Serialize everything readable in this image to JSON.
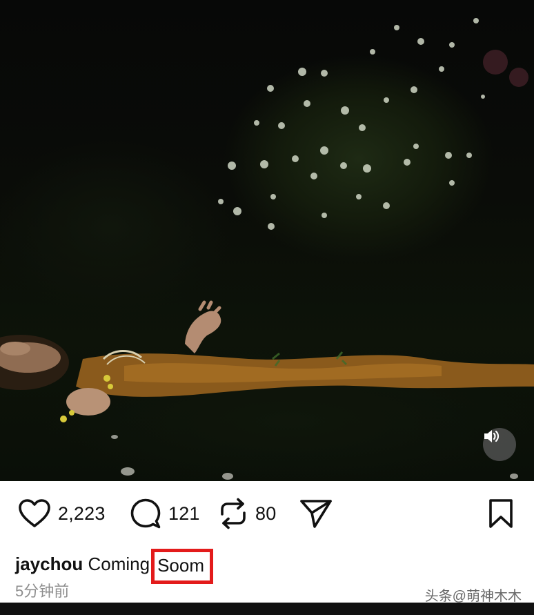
{
  "media": {
    "type": "video",
    "sound_icon": "speaker-icon"
  },
  "actions": {
    "like_icon": "heart-icon",
    "like_count": "2,223",
    "comment_icon": "comment-bubble-icon",
    "comment_count": "121",
    "repost_icon": "repost-arrows-icon",
    "repost_count": "80",
    "share_icon": "send-icon",
    "save_icon": "bookmark-icon"
  },
  "caption": {
    "username": "jaychou",
    "text": "Coming",
    "highlight": "Soom",
    "highlight_color": "#e31b1b"
  },
  "timestamp": "5分钟前",
  "watermark": "头条@萌神木木"
}
